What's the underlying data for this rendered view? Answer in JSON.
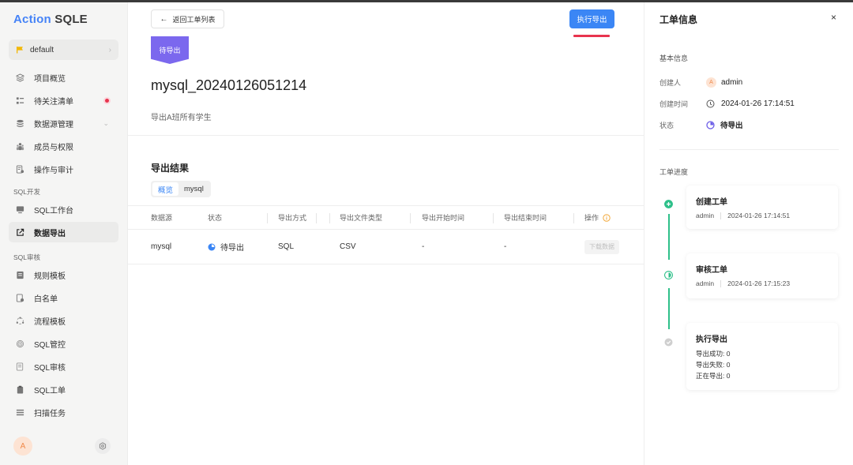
{
  "brand": {
    "part1": "Action",
    "part2": "SQLE"
  },
  "project": {
    "name": "default"
  },
  "nav": {
    "items": [
      {
        "label": "项目概览"
      },
      {
        "label": "待关注清单"
      },
      {
        "label": "数据源管理"
      },
      {
        "label": "成员与权限"
      },
      {
        "label": "操作与审计"
      }
    ],
    "sql_dev_section": "SQL开发",
    "sql_dev_items": [
      {
        "label": "SQL工作台"
      },
      {
        "label": "数据导出"
      }
    ],
    "sql_audit_section": "SQL审核",
    "sql_audit_items": [
      {
        "label": "规则模板"
      },
      {
        "label": "白名单"
      },
      {
        "label": "流程模板"
      },
      {
        "label": "SQL管控"
      },
      {
        "label": "SQL审核"
      },
      {
        "label": "SQL工单"
      },
      {
        "label": "扫描任务"
      }
    ]
  },
  "user": {
    "avatar_letter": "A"
  },
  "header": {
    "back_label": "返回工单列表",
    "execute_label": "执行导出"
  },
  "order": {
    "status_ribbon": "待导出",
    "title": "mysql_20240126051214",
    "description": "导出A班所有学生"
  },
  "result": {
    "title": "导出结果",
    "tabs": [
      "概览",
      "mysql"
    ],
    "columns": [
      "数据源",
      "状态",
      "导出方式",
      "导出文件类型",
      "导出开始时间",
      "导出结束时间",
      "操作"
    ],
    "rows": [
      {
        "source": "mysql",
        "status": "待导出",
        "method": "SQL",
        "file_type": "CSV",
        "start": "-",
        "end": "-",
        "action": "下载数据"
      }
    ]
  },
  "panel": {
    "title": "工单信息",
    "close": "×",
    "basic_title": "基本信息",
    "creator_label": "创建人",
    "creator_avatar": "A",
    "creator": "admin",
    "created_label": "创建时间",
    "created_at": "2024-01-26 17:14:51",
    "status_label": "状态",
    "status": "待导出",
    "progress_title": "工单进度",
    "steps": [
      {
        "title": "创建工单",
        "user": "admin",
        "time": "2024-01-26 17:14:51"
      },
      {
        "title": "审核工单",
        "user": "admin",
        "time": "2024-01-26 17:15:23"
      },
      {
        "title": "执行导出",
        "lines": [
          "导出成功: 0",
          "导出失败: 0",
          "正在导出: 0"
        ]
      }
    ]
  },
  "colors": {
    "accent": "#3b86f5",
    "ribbon": "#7b68ee",
    "success": "#2fc08a",
    "alert": "#e8344e"
  }
}
